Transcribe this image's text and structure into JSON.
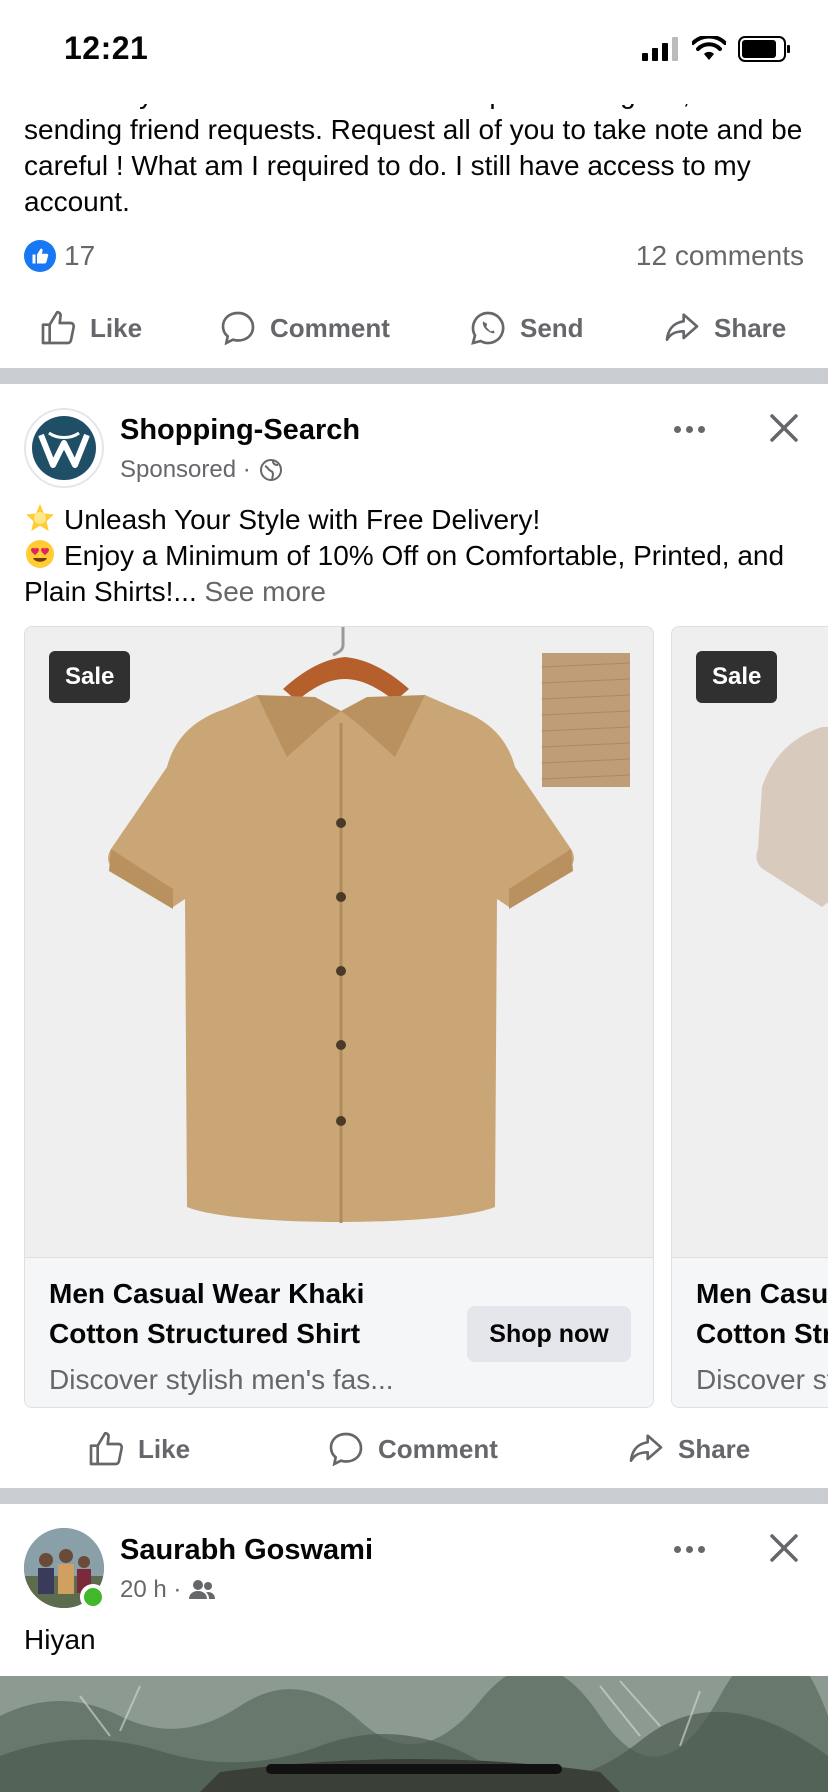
{
  "status_bar": {
    "time": "12:21"
  },
  "post1": {
    "text": "somebody has created an account impersonating me, and is sending friend requests. Request all of you to take note and be careful ! What am I required to do. I still have access to my account.",
    "likes": "17",
    "comments": "12 comments",
    "actions": {
      "like": "Like",
      "comment": "Comment",
      "send": "Send",
      "share": "Share"
    }
  },
  "ad_post": {
    "page_name": "Shopping-Search",
    "meta": "Sponsored ·",
    "line1": "Unleash Your Style with Free Delivery!",
    "line2": "Enjoy a Minimum of 10% Off on Comfortable, Printed, and Plain Shirts!...",
    "see_more": "See more",
    "cards": [
      {
        "badge": "Sale",
        "title": "Men Casual Wear Khaki Cotton Structured Shirt",
        "description": "Discover stylish men's fas...",
        "cta": "Shop now"
      },
      {
        "badge": "Sale",
        "title": "Men Casual Wear Khaki Cotton Structured Shirt",
        "description": "Discover stylish men's fas..."
      }
    ],
    "actions": {
      "like": "Like",
      "comment": "Comment",
      "share": "Share"
    }
  },
  "post3": {
    "author": "Saurabh Goswami",
    "meta": "20 h ·",
    "text": "Hiyan"
  },
  "colors": {
    "accent": "#1877f2",
    "muted": "#65676b",
    "divider": "#c9ccd1",
    "shirt": "#caa576"
  }
}
